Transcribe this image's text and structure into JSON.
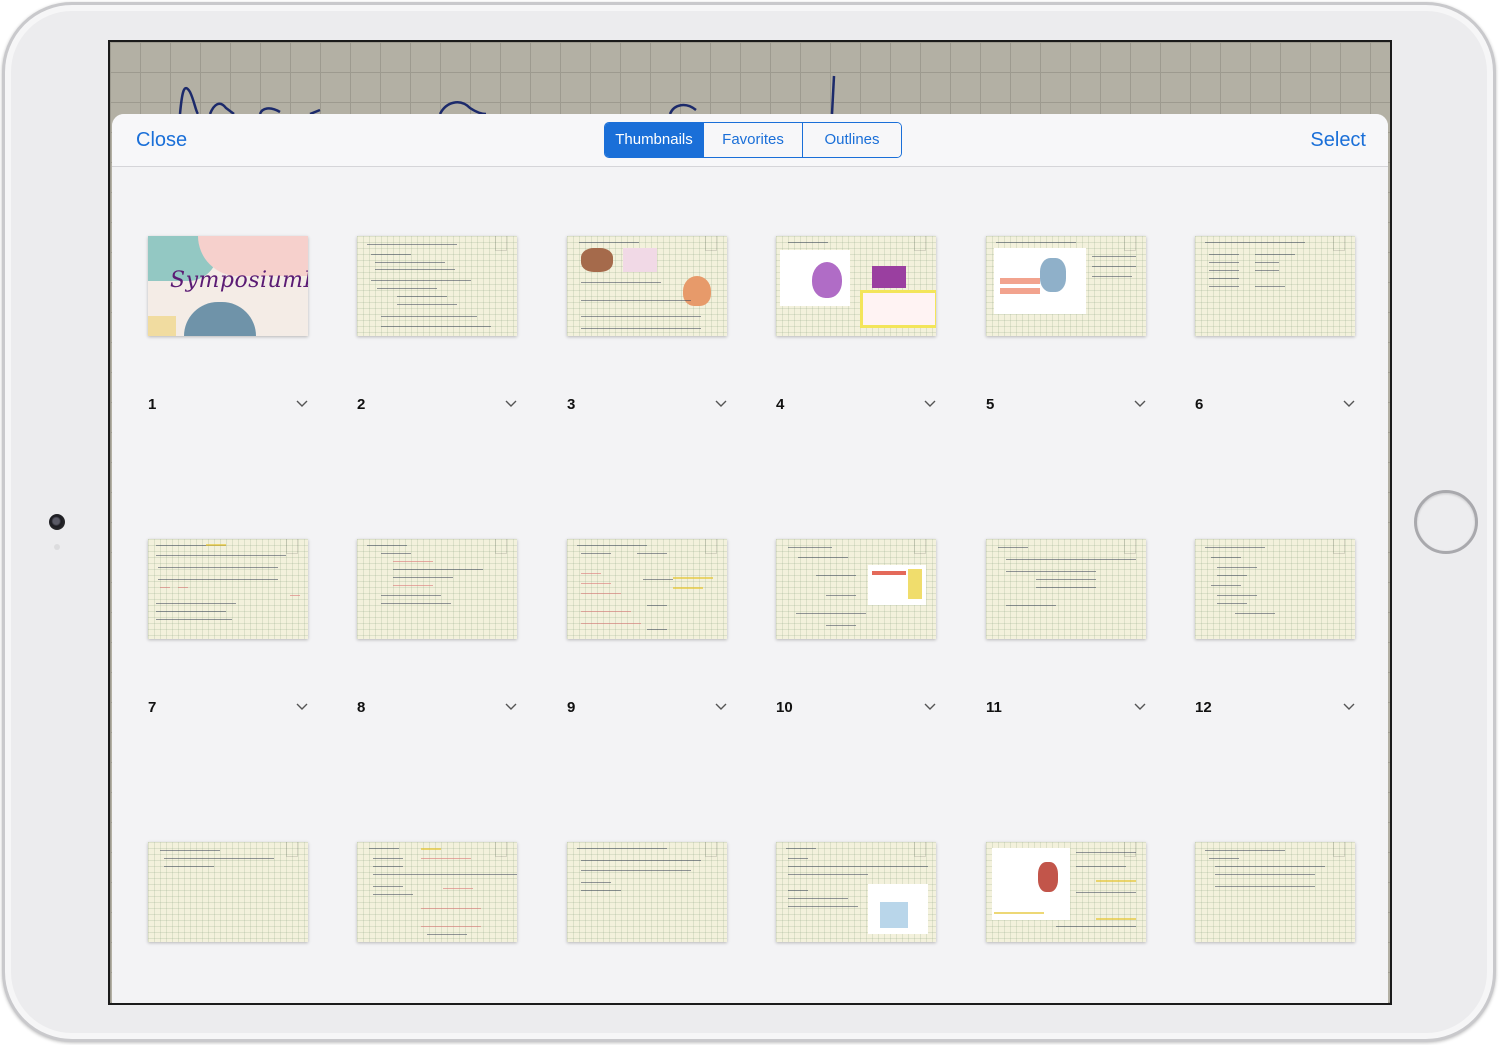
{
  "header": {
    "close_label": "Close",
    "select_label": "Select",
    "tabs": [
      {
        "label": "Thumbnails",
        "active": true
      },
      {
        "label": "Favorites",
        "active": false
      },
      {
        "label": "Outlines",
        "active": false
      }
    ],
    "accent_color": "#1a6fd8"
  },
  "cover": {
    "title": "SymposiumI"
  },
  "pages": [
    {
      "number": "1"
    },
    {
      "number": "2"
    },
    {
      "number": "3"
    },
    {
      "number": "4"
    },
    {
      "number": "5"
    },
    {
      "number": "6"
    },
    {
      "number": "7"
    },
    {
      "number": "8"
    },
    {
      "number": "9"
    },
    {
      "number": "10"
    },
    {
      "number": "11"
    },
    {
      "number": "12"
    },
    {
      "number": ""
    },
    {
      "number": ""
    },
    {
      "number": ""
    },
    {
      "number": ""
    },
    {
      "number": ""
    },
    {
      "number": ""
    }
  ],
  "icons": {
    "page_menu": "chevron-down-icon",
    "bookmark": "bookmark-icon"
  }
}
